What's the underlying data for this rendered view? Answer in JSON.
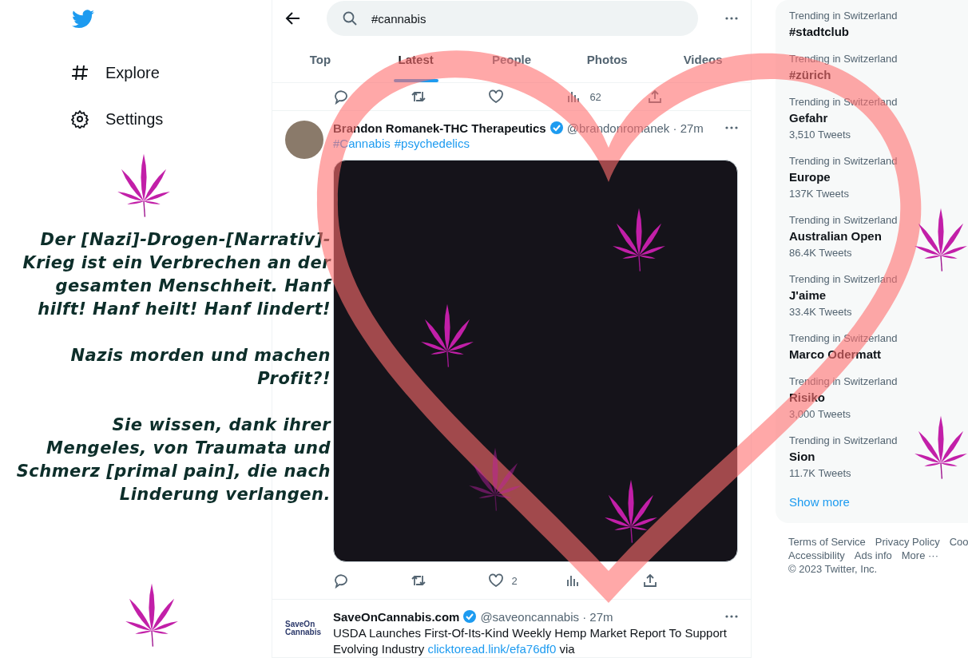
{
  "sidebar": {
    "nav": [
      {
        "kind": "explore",
        "label": "Explore"
      },
      {
        "kind": "settings",
        "label": "Settings"
      }
    ]
  },
  "overlay_text": [
    "Der [Nazi]-Drogen-[Narrativ]-Krieg ist ein Verbrechen an der gesamten Menschheit. Hanf hilft! Hanf heilt! Hanf lindert!",
    "Nazis morden und machen Profit?!",
    "Sie wissen, dank ihrer Mengeles, von Traumata und Schmerz [primal pain], die nach Linderung verlangen."
  ],
  "search": {
    "value": "#cannabis"
  },
  "tabs": [
    {
      "label": "Top",
      "selected": false
    },
    {
      "label": "Latest",
      "selected": true
    },
    {
      "label": "People",
      "selected": false
    },
    {
      "label": "Photos",
      "selected": false
    },
    {
      "label": "Videos",
      "selected": false
    }
  ],
  "previous_tweet_actions": [
    {
      "kind": "reply"
    },
    {
      "kind": "retweet"
    },
    {
      "kind": "like"
    },
    {
      "kind": "views",
      "count": "62"
    },
    {
      "kind": "share"
    }
  ],
  "tweets": [
    {
      "name": "Brandon Romanek-THC Therapeutics",
      "verified": true,
      "handle": "@brandonromanek · 27m",
      "hashtags": [
        "#Cannabis",
        "#psychedelics"
      ],
      "media": true,
      "actions": [
        {
          "kind": "reply"
        },
        {
          "kind": "retweet"
        },
        {
          "kind": "like",
          "count": "2"
        },
        {
          "kind": "views"
        },
        {
          "kind": "share"
        }
      ]
    },
    {
      "avatar_lines": [
        "SaveOn",
        "Cannabis"
      ],
      "name": "SaveOnCannabis.com",
      "verified": true,
      "handle": "@saveoncannabis · 27m",
      "text": "USDA Launches First-Of-Its-Kind Weekly Hemp Market Report To Support Evolving Industry",
      "link": "clicktoread.link/efa76df0",
      "text_after": "via"
    }
  ],
  "trends": [
    {
      "context": "Trending in Switzerland",
      "title": "#stadtclub"
    },
    {
      "context": "Trending in Switzerland",
      "title": "#zürich"
    },
    {
      "context": "Trending in Switzerland",
      "title": "Gefahr",
      "count": "3,510 Tweets"
    },
    {
      "context": "Trending in Switzerland",
      "title": "Europe",
      "count": "137K Tweets"
    },
    {
      "context": "Trending in Switzerland",
      "title": "Australian Open",
      "count": "86.4K Tweets"
    },
    {
      "context": "Trending in Switzerland",
      "title": "J'aime",
      "count": "33.4K Tweets"
    },
    {
      "context": "Trending in Switzerland",
      "title": "Marco Odermatt"
    },
    {
      "context": "Trending in Switzerland",
      "title": "Risiko",
      "count": "3,000 Tweets"
    },
    {
      "context": "Trending in Switzerland",
      "title": "Sion",
      "count": "11.7K Tweets"
    }
  ],
  "show_more": "Show more",
  "footer": {
    "links": [
      "Terms of Service",
      "Privacy Policy",
      "Coo",
      "Accessibility",
      "Ads info",
      "More ···"
    ],
    "copyright": "© 2023 Twitter, Inc."
  }
}
